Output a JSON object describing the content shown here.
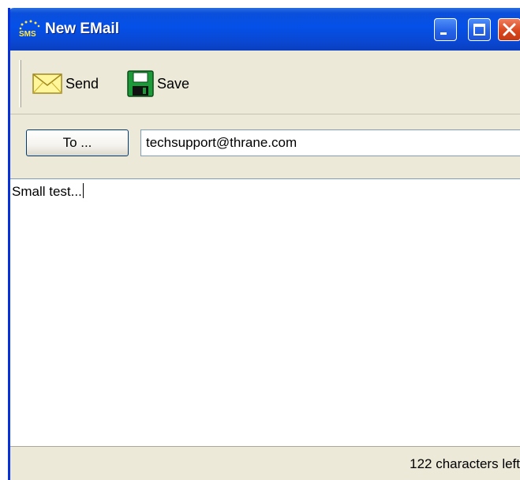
{
  "window": {
    "title": "New EMail",
    "app_icon_label": "SMS"
  },
  "titlebar_buttons": {
    "minimize": "minimize",
    "maximize": "maximize",
    "close": "close"
  },
  "toolbar": {
    "send_label": "Send",
    "save_label": "Save"
  },
  "recipient": {
    "to_button_label": "To ...",
    "to_value": "techsupport@thrane.com"
  },
  "message": {
    "body": "Small test..."
  },
  "status": {
    "chars_left": "122 characters left"
  },
  "icons": [
    "sms-app-icon",
    "envelope-icon",
    "floppy-disk-icon",
    "minimize-icon",
    "maximize-icon",
    "close-icon"
  ],
  "colors": {
    "titlebar": "#0450e8",
    "window_frame": "#0831d9",
    "close_button": "#d9481e",
    "chrome": "#ece9d8"
  }
}
